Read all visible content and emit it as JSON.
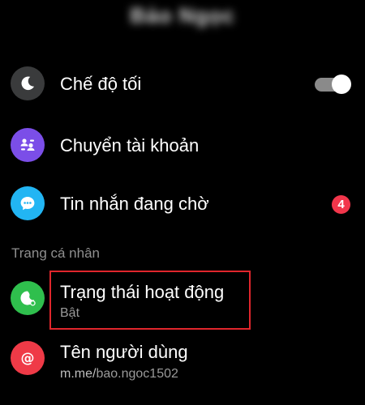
{
  "header": {
    "name": "Bảo Ngọc"
  },
  "menu": {
    "dark_mode": {
      "label": "Chế độ tối",
      "toggle_on": true,
      "icon": "moon-icon",
      "icon_bg": "#3a3b3c"
    },
    "switch_account": {
      "label": "Chuyển tài khoản",
      "icon": "switch-account-icon",
      "icon_bg": "#7b4ee8"
    },
    "message_requests": {
      "label": "Tin nhắn đang chờ",
      "badge": "4",
      "icon": "chat-bubble-icon",
      "icon_bg": "#22b5f3",
      "badge_color": "#f2364b"
    }
  },
  "profile_section": {
    "title": "Trang cá nhân",
    "active_status": {
      "label": "Trạng thái hoạt động",
      "value": "Bật",
      "icon": "active-status-icon",
      "icon_bg": "#2fbf4d"
    },
    "username": {
      "label": "Tên người dùng",
      "url_prefix": "m.me/",
      "url_handle": "bao.ngoc1502",
      "icon": "at-sign-icon",
      "icon_bg": "#ef3a47"
    }
  },
  "highlight_color": "#e0262c"
}
